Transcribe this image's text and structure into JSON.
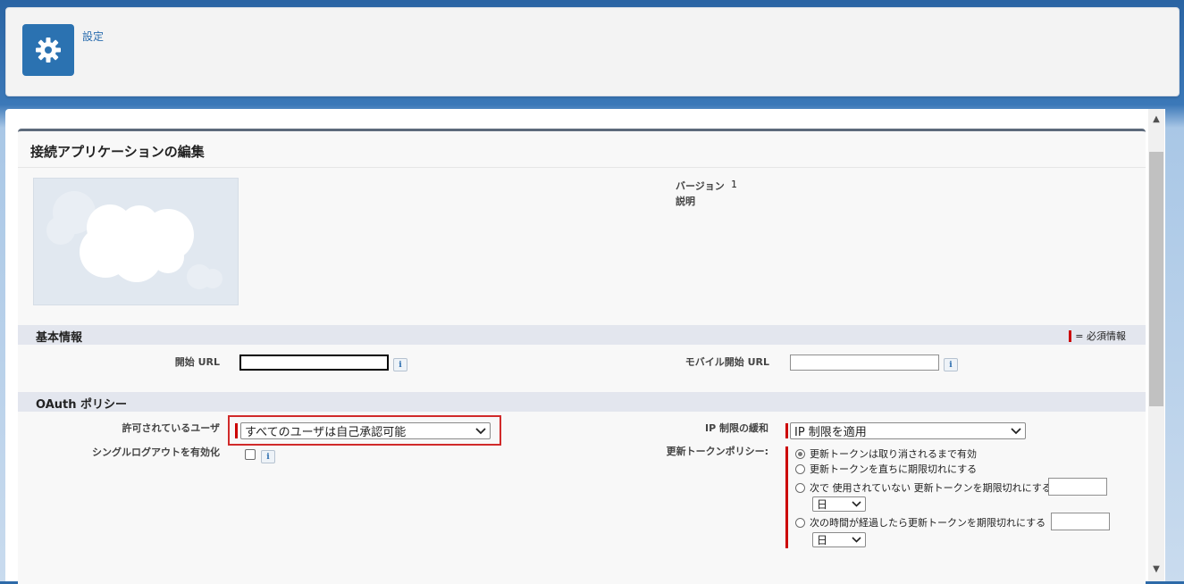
{
  "header": {
    "title": "設定",
    "icon": "gear-icon"
  },
  "edit": {
    "title": "接続アプリケーションの編集",
    "version_label": "バージョン",
    "version_value": "1",
    "description_label": "説明"
  },
  "basic_info": {
    "section_title": "基本情報",
    "required_legend": "= 必須情報",
    "start_url_label": "開始 URL",
    "start_url_value": "",
    "mobile_start_url_label": "モバイル開始 URL",
    "mobile_start_url_value": "",
    "info_icon_text": "i"
  },
  "oauth": {
    "section_title": "OAuth ポリシー",
    "permitted_users_label": "許可されているユーザ",
    "permitted_users_value": "すべてのユーザは自己承認可能",
    "single_logout_label": "シングルログアウトを有効化",
    "single_logout_checked": false,
    "ip_relax_label": "IP 制限の緩和",
    "ip_relax_value": "IP 制限を適用",
    "refresh_policy_label": "更新トークンポリシー:",
    "refresh_options": [
      "更新トークンは取り消されるまで有効",
      "更新トークンを直ちに期限切れにする",
      "次で 使用されていない 更新トークンを期限切れにする",
      "次の時間が経過したら更新トークンを期限切れにする"
    ],
    "refresh_selected_index": 0,
    "unit_value_1": "日",
    "unit_value_2": "日"
  },
  "colors": {
    "accent": "#2b72b1",
    "required": "#cc0000",
    "highlight": "#d12a2a"
  }
}
